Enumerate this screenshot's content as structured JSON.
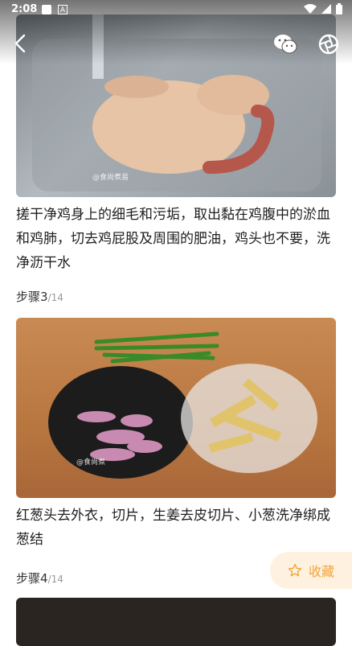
{
  "status_bar": {
    "time": "2:08",
    "a_glyph": "A"
  },
  "nav": {
    "back_icon": "back-arrow-icon",
    "share_icon": "wechat-icon",
    "camera_icon": "shutter-icon"
  },
  "steps": [
    {
      "image": "washed-chicken-in-sink-photo",
      "image_watermark": "@食尚煮易",
      "description": "搓干净鸡身上的细毛和污垢，取出黏在鸡腹中的淤血和鸡肺，切去鸡屁股及周围的肥油，鸡头也不要，洗净沥干水"
    },
    {
      "label": "步骤",
      "number": "3",
      "total": "/14",
      "image": "shallots-ginger-scallions-photo",
      "image_watermark": "@食尚煮",
      "description": "红葱头去外衣，切片，生姜去皮切片、小葱洗净绑成葱结"
    },
    {
      "label": "步骤",
      "number": "4",
      "total": "/14",
      "image": "next-step-photo"
    }
  ],
  "favorite": {
    "label": "收藏",
    "icon": "star-icon",
    "color": "#f0a43a"
  }
}
